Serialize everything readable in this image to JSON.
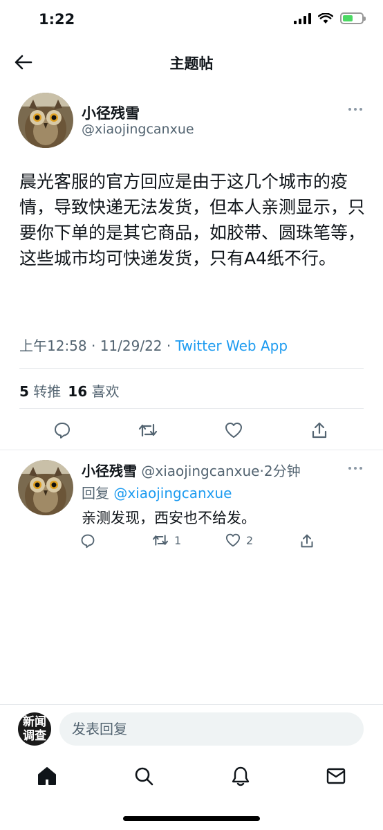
{
  "status_bar": {
    "time": "1:22"
  },
  "header": {
    "title": "主题帖"
  },
  "tweet": {
    "author_name": "小径残雪",
    "author_handle": "@xiaojingcanxue",
    "text": "晨光客服的官方回应是由于这几个城市的疫情，导致快递无法发货，但本人亲测显示，只要你下单的是其它商品，如胶带、圆珠笔等，这些城市均可快递发货，只有A4纸不行。",
    "timestamp": "上午12:58 · 11/29/22 · ",
    "source": "Twitter Web App",
    "retweets_count": "5",
    "retweets_label": "转推",
    "likes_count": "16",
    "likes_label": "喜欢"
  },
  "reply": {
    "author_name": "小径残雪",
    "author_handle": "@xiaojingcanxue",
    "time_ago": "·2分钟",
    "replying_to_label": "回复",
    "replying_to_handle": "@xiaojingcanxue",
    "text": "亲测发现，西安也不给发。",
    "retweets": "1",
    "likes": "2"
  },
  "compose": {
    "avatar_text_line1": "新闻",
    "avatar_text_line2": "调查",
    "placeholder": "发表回复"
  },
  "colors": {
    "accent": "#1d9bf0",
    "secondary_text": "#536471",
    "battery": "#4cd964"
  },
  "icons": {
    "back": "arrow-left-icon",
    "more": "ellipsis-icon",
    "reply": "comment-icon",
    "retweet": "retweet-icon",
    "like": "heart-icon",
    "share": "share-icon",
    "home": "home-icon",
    "search": "search-icon",
    "notifications": "bell-icon",
    "messages": "mail-icon"
  }
}
